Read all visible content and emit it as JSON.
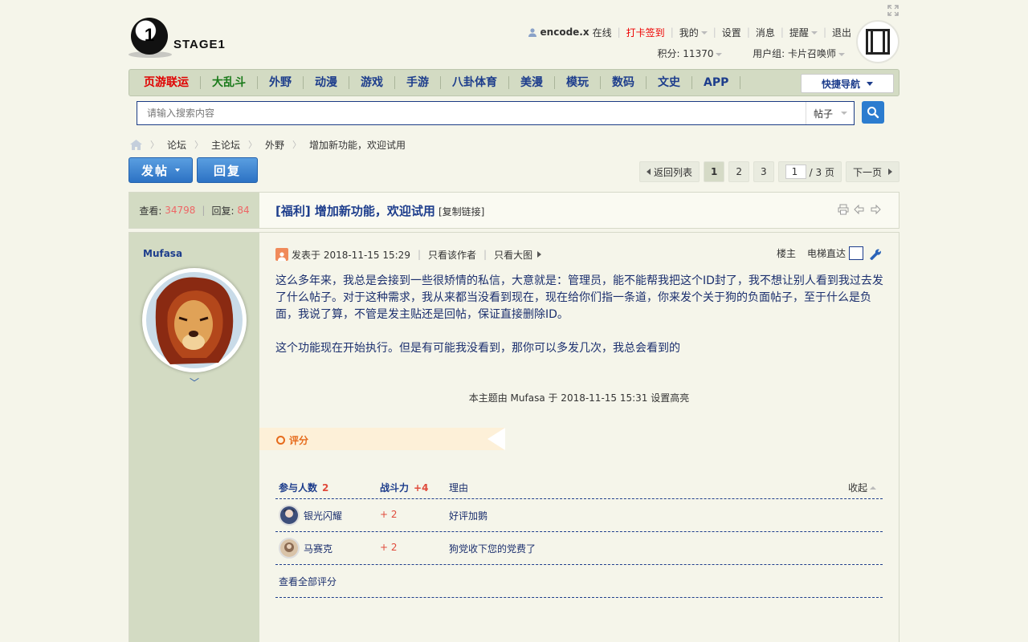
{
  "logo": {
    "mark": "1",
    "text": "STAGE1"
  },
  "user": {
    "name": "encode.x",
    "status": "在线",
    "checkin": "打卡签到",
    "mine": "我的",
    "settings": "设置",
    "messages": "消息",
    "reminders": "提醒",
    "logout": "退出",
    "points_label": "积分: 11370",
    "group_label": "用户组: 卡片召唤师"
  },
  "nav": {
    "items": [
      {
        "label": "页游联运",
        "color": "#e00000"
      },
      {
        "label": "大乱斗",
        "color": "#1a7a1a"
      },
      {
        "label": "外野",
        "color": "#1d3d8c"
      },
      {
        "label": "动漫",
        "color": "#1d3d8c"
      },
      {
        "label": "游戏",
        "color": "#1d3d8c"
      },
      {
        "label": "手游",
        "color": "#1d3d8c"
      },
      {
        "label": "八卦体育",
        "color": "#1d3d8c"
      },
      {
        "label": "美漫",
        "color": "#1d3d8c"
      },
      {
        "label": "模玩",
        "color": "#1d3d8c"
      },
      {
        "label": "数码",
        "color": "#1d3d8c"
      },
      {
        "label": "文史",
        "color": "#1d3d8c"
      },
      {
        "label": "APP",
        "color": "#1d3d8c"
      }
    ],
    "quick_nav": "快捷导航"
  },
  "search": {
    "placeholder": "请输入搜索内容",
    "type": "帖子"
  },
  "breadcrumb": [
    "论坛",
    "主论坛",
    "外野",
    "增加新功能，欢迎试用"
  ],
  "actions": {
    "post": "发帖",
    "reply": "回复"
  },
  "pager": {
    "back": "返回列表",
    "pages": [
      "1",
      "2",
      "3"
    ],
    "current": "1",
    "input_value": "1",
    "total": "/ 3 页",
    "next": "下一页"
  },
  "thread": {
    "views_label": "查看:",
    "views": "34798",
    "replies_label": "回复:",
    "replies": "84",
    "title": "[福利] 增加新功能，欢迎试用",
    "copy_link": "[复制链接]"
  },
  "post": {
    "author": "Mufasa",
    "posted_at": "发表于 2018-11-15 15:29",
    "only_author": "只看该作者",
    "big_image": "只看大图",
    "floor": "楼主",
    "elevator": "电梯直达",
    "paragraphs": [
      "这么多年来，我总是会接到一些很矫情的私信，大意就是：管理员，能不能帮我把这个ID封了，我不想让别人看到我过去发了什么帖子。对于这种需求，我从来都当没看到现在，现在给你们指一条道，你来发个关于狗的负面帖子，至于什么是负面，我说了算，不管是发主贴还是回帖，保证直接删除ID。",
      "这个功能现在开始执行。但是有可能我没看到，那你可以多发几次，我总会看到的"
    ],
    "edit_note": "本主题由 Mufasa 于 2018-11-15 15:31 设置高亮"
  },
  "rating": {
    "tab": "评分",
    "col_people": "参与人数",
    "people_count": "2",
    "col_power": "战斗力",
    "power_total": "+4",
    "col_reason": "理由",
    "collapse": "收起",
    "rows": [
      {
        "user": "银光闪耀",
        "value": "+ 2",
        "reason": "好评加鹅"
      },
      {
        "user": "马赛克",
        "value": "+ 2",
        "reason": "狗党收下您的党费了"
      }
    ],
    "view_all": "查看全部评分"
  }
}
